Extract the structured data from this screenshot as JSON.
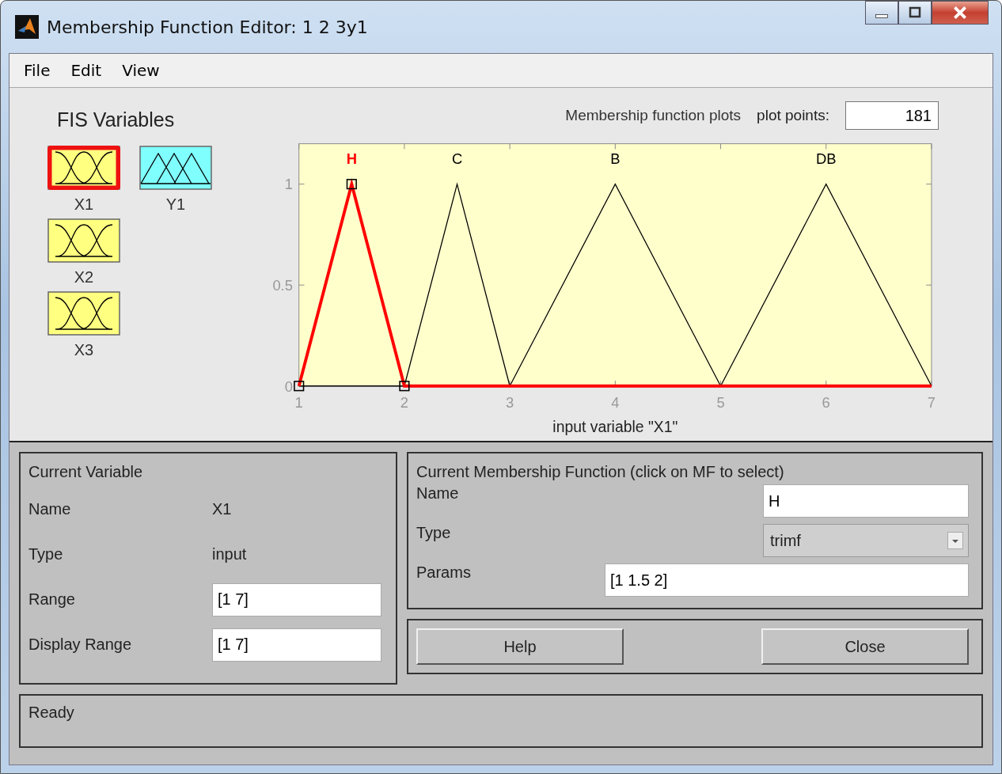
{
  "window": {
    "title": "Membership Function Editor: 1 2 3y1"
  },
  "menu": [
    "File",
    "Edit",
    "View"
  ],
  "fis_variables": {
    "title": "FIS Variables",
    "items": [
      {
        "name": "X1",
        "kind": "input",
        "selected": true
      },
      {
        "name": "Y1",
        "kind": "output",
        "selected": false
      },
      {
        "name": "X2",
        "kind": "input",
        "selected": false
      },
      {
        "name": "X3",
        "kind": "input",
        "selected": false
      }
    ]
  },
  "plot": {
    "title": "Membership function plots",
    "plot_points_label": "plot points:",
    "plot_points": "181",
    "chart_data": {
      "type": "line",
      "xlabel": "input variable \"X1\"",
      "x": [
        1,
        1.5,
        2,
        2.5,
        3,
        4,
        5,
        6,
        7
      ],
      "xlim": [
        1,
        7
      ],
      "ylim": [
        0,
        1.2
      ],
      "xticks": [
        1,
        2,
        3,
        4,
        5,
        6,
        7
      ],
      "yticks": [
        0,
        0.5,
        1
      ],
      "series": [
        {
          "name": "H",
          "color": "#ff0000",
          "values": [
            0,
            1,
            0,
            0,
            0,
            0,
            0,
            0,
            0
          ]
        },
        {
          "name": "C",
          "color": "#000000",
          "values": [
            0,
            0,
            0,
            1,
            0,
            null,
            null,
            null,
            null
          ]
        },
        {
          "name": "B",
          "color": "#000000",
          "values": [
            null,
            null,
            null,
            null,
            0,
            1,
            0,
            null,
            null
          ]
        },
        {
          "name": "DB",
          "color": "#000000",
          "values": [
            null,
            null,
            null,
            null,
            null,
            null,
            0,
            1,
            0
          ]
        }
      ]
    }
  },
  "current_variable": {
    "title": "Current Variable",
    "name_label": "Name",
    "name": "X1",
    "type_label": "Type",
    "type": "input",
    "range_label": "Range",
    "range": "[1 7]",
    "display_range_label": "Display Range",
    "display_range": "[1 7]"
  },
  "current_mf": {
    "title": "Current Membership Function (click on MF to select)",
    "name_label": "Name",
    "name": "H",
    "type_label": "Type",
    "type": "trimf",
    "params_label": "Params",
    "params": "[1 1.5 2]"
  },
  "buttons": [
    "Help",
    "Close"
  ],
  "status_bar": "Ready"
}
